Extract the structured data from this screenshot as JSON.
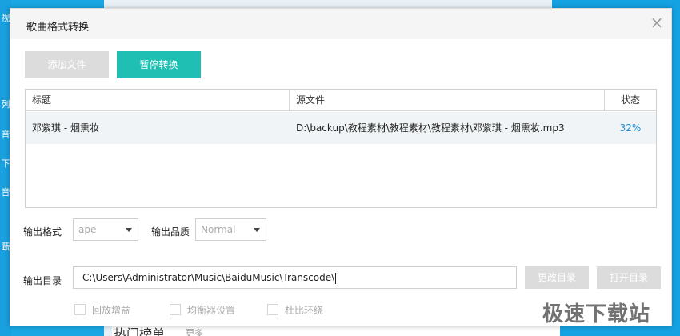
{
  "dialog": {
    "title": "歌曲格式转换",
    "close_glyph": "×"
  },
  "toolbar": {
    "add_label": "添加文件",
    "pause_label": "暂停转换"
  },
  "table": {
    "columns": [
      "标题",
      "源文件",
      "状态"
    ],
    "rows": [
      {
        "title": "邓紫琪 - 烟熏妆",
        "source": "D:\\backup\\教程素材\\教程素材\\教程素材\\邓紫琪  -  烟熏妆.mp3",
        "status": "32%"
      }
    ]
  },
  "settings": {
    "format_label": "输出格式",
    "format_value": "ape",
    "quality_label": "输出品质",
    "quality_value": "Normal",
    "dir_label": "输出目录",
    "dir_value": "C:\\Users\\Administrator\\Music\\BaiduMusic\\Transcode\\",
    "change_dir_label": "更改目录",
    "open_dir_label": "打开目录"
  },
  "options": [
    {
      "label": "回放增益",
      "checked": false
    },
    {
      "label": "均衡器设置",
      "checked": false
    },
    {
      "label": "杜比环绕",
      "checked": false
    }
  ],
  "background": {
    "left_chars": [
      "视",
      "列",
      "音",
      "下",
      "音",
      "蔬"
    ],
    "bottom_hot": "热门榜单",
    "bottom_more": "更多"
  },
  "watermark": "极速下载站",
  "colors": {
    "accent": "#1fc0b3",
    "status_blue": "#1a8fd8",
    "app_blue": "#1aa7e4"
  }
}
